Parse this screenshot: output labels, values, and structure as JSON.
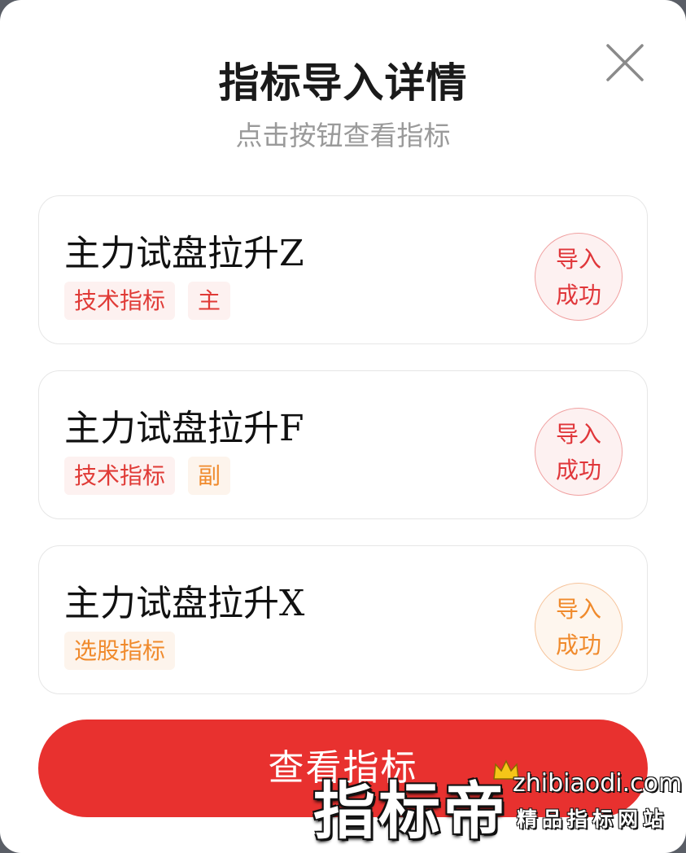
{
  "dialog": {
    "title": "指标导入详情",
    "subtitle": "点击按钮查看指标"
  },
  "items": [
    {
      "name": "主力试盘拉升Z",
      "tags": [
        {
          "label": "技术指标",
          "color": "#e03a36"
        },
        {
          "label": "主",
          "color": "#e03a36"
        }
      ],
      "status": [
        "导入",
        "成功"
      ],
      "status_color": "#e0363a"
    },
    {
      "name": "主力试盘拉升F",
      "tags": [
        {
          "label": "技术指标",
          "color": "#e03a36"
        },
        {
          "label": "副",
          "color": "#f08a2c"
        }
      ],
      "status": [
        "导入",
        "成功"
      ],
      "status_color": "#e0363a"
    },
    {
      "name": "主力试盘拉升X",
      "tags": [
        {
          "label": "选股指标",
          "color": "#f08a2c"
        }
      ],
      "status": [
        "导入",
        "成功"
      ],
      "status_color": "#f08a2c"
    }
  ],
  "actions": {
    "view_label": "查看指标",
    "close_icon": "close-icon"
  },
  "watermark": {
    "brand": "指标帝",
    "url": "zhibiaodi.com",
    "tagline": "精品指标网站"
  },
  "colors": {
    "accent": "#e8312f",
    "orange": "#f08a2c"
  }
}
